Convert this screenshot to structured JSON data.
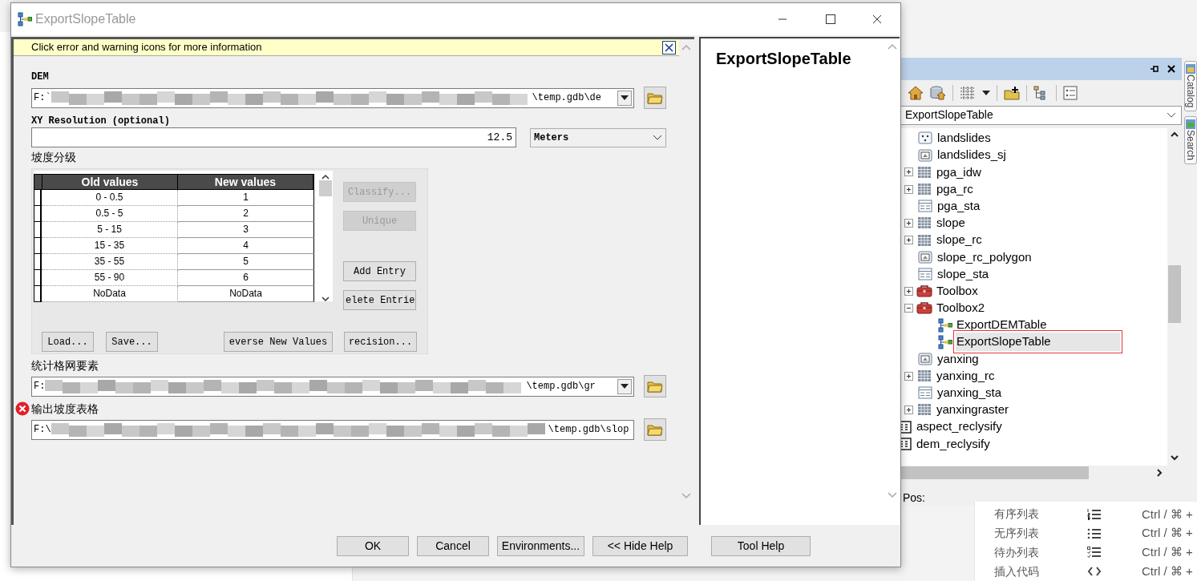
{
  "dialog": {
    "title": "ExportSlopeTable"
  },
  "info_bar": {
    "message": "Click error and warning icons for more information"
  },
  "parameters": [
    {
      "kind": "path",
      "label": "DEM",
      "value_start": "F:`",
      "value_end": "\\temp.gdb\\de",
      "dropdown": true,
      "error": false
    },
    {
      "kind": "number",
      "label": "XY Resolution (optional)",
      "value": "12.5",
      "unit": "Meters"
    },
    {
      "kind": "remap",
      "label": "坡度分级",
      "columns": [
        "Old values",
        "New values"
      ],
      "rows": [
        [
          "0 - 0.5",
          "1"
        ],
        [
          "0.5 - 5",
          "2"
        ],
        [
          "5 - 15",
          "3"
        ],
        [
          "15 - 35",
          "4"
        ],
        [
          "35 - 55",
          "5"
        ],
        [
          "55 - 90",
          "6"
        ],
        [
          "NoData",
          "NoData"
        ]
      ],
      "side_buttons": [
        {
          "label": "Classify...",
          "disabled": true
        },
        {
          "label": "Unique",
          "disabled": true
        },
        {
          "label": "Add Entry",
          "disabled": false
        },
        {
          "label": "elete Entrie",
          "disabled": false
        }
      ],
      "bottom_buttons": [
        {
          "label": "Load...",
          "disabled": false
        },
        {
          "label": "Save...",
          "disabled": false
        },
        {
          "label": "everse New Values",
          "disabled": false
        },
        {
          "label": "recision...",
          "disabled": false
        }
      ]
    },
    {
      "kind": "path",
      "label": "统计格网要素",
      "value_start": "F:",
      "value_end": "\\temp.gdb\\gr",
      "dropdown": true,
      "error": false
    },
    {
      "kind": "path",
      "label": "输出坡度表格",
      "value_start": "F:\\",
      "value_end": "\\temp.gdb\\slop",
      "dropdown": false,
      "error": true
    }
  ],
  "help": {
    "title": "ExportSlopeTable"
  },
  "footer_buttons": [
    "OK",
    "Cancel",
    "Environments...",
    "<< Hide Help",
    "Tool Help"
  ],
  "catalog": {
    "location": "ExportSlopeTable",
    "branch": [
      {
        "label": "landslides",
        "kind": "points",
        "expandable": false
      },
      {
        "label": "landslides_sj",
        "kind": "polygon",
        "expandable": false
      },
      {
        "label": "pga_idw",
        "kind": "raster",
        "expandable": true,
        "expanded": false
      },
      {
        "label": "pga_rc",
        "kind": "raster",
        "expandable": true,
        "expanded": false
      },
      {
        "label": "pga_sta",
        "kind": "table",
        "expandable": false
      },
      {
        "label": "slope",
        "kind": "raster",
        "expandable": true,
        "expanded": false
      },
      {
        "label": "slope_rc",
        "kind": "raster",
        "expandable": true,
        "expanded": false
      },
      {
        "label": "slope_rc_polygon",
        "kind": "polygon",
        "expandable": false
      },
      {
        "label": "slope_sta",
        "kind": "table",
        "expandable": false
      },
      {
        "label": "Toolbox",
        "kind": "toolbox",
        "expandable": true,
        "expanded": false
      },
      {
        "label": "Toolbox2",
        "kind": "toolbox",
        "expandable": true,
        "expanded": true,
        "children": [
          {
            "label": "ExportDEMTable",
            "kind": "tool",
            "selected": false,
            "outlined": false
          },
          {
            "label": "ExportSlopeTable",
            "kind": "tool",
            "selected": true,
            "outlined": true
          }
        ]
      },
      {
        "label": "yanxing",
        "kind": "polygon",
        "expandable": false
      },
      {
        "label": "yanxing_rc",
        "kind": "raster",
        "expandable": true,
        "expanded": false
      },
      {
        "label": "yanxing_sta",
        "kind": "table",
        "expandable": false
      },
      {
        "label": "yanxingraster",
        "kind": "raster",
        "expandable": true,
        "expanded": false
      }
    ],
    "items": [
      {
        "label": "aspect_reclysify",
        "kind": "dbtable"
      },
      {
        "label": "dem_reclysify",
        "kind": "dbtable"
      }
    ],
    "status": "Pos:"
  },
  "side_tabs": [
    "Catalog",
    "Search"
  ],
  "shortcut_menu": [
    {
      "label": "有序列表",
      "kind": "ordered",
      "shortcut": "Ctrl / ⌘ +"
    },
    {
      "label": "无序列表",
      "kind": "unordered",
      "shortcut": "Ctrl / ⌘ +"
    },
    {
      "label": "待办列表",
      "kind": "todo",
      "shortcut": "Ctrl / ⌘ +"
    },
    {
      "label": "插入代码",
      "kind": "code",
      "shortcut": "Ctrl / ⌘ +"
    }
  ]
}
